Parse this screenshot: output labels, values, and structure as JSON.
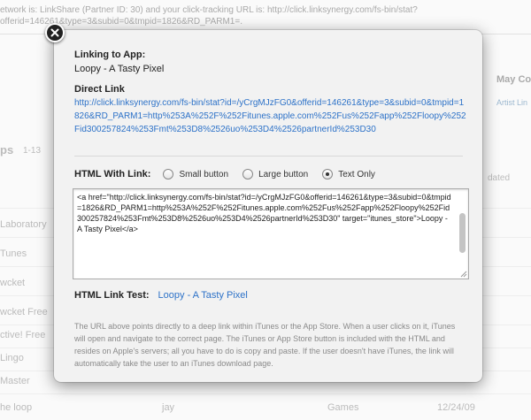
{
  "background": {
    "topline": "etwork is: LinkShare (Partner ID: 30) and your click-tracking URL is: http://click.linksynergy.com/fs-bin/stat?",
    "topline2": "offerid=146261&type=3&subid=0&tmpid=1826&RD_PARM1=.",
    "apps_title": "ps",
    "apps_count": "1-13",
    "side_title": "May Co",
    "side_link": "Artist Lin",
    "updated_header": "dated",
    "rows": [
      {
        "name": "",
        "artist": "",
        "genre": "",
        "date": ""
      },
      {
        "name": "Laboratory",
        "artist": "",
        "genre": "",
        "date": ""
      },
      {
        "name": "Tunes",
        "artist": "",
        "genre": "",
        "date": ""
      },
      {
        "name": "wcket",
        "artist": "",
        "genre": "",
        "date": ""
      },
      {
        "name": "wcket Free",
        "artist": "",
        "genre": "",
        "date": ""
      },
      {
        "name": "ctive! Free",
        "artist": "",
        "genre": "",
        "date": ""
      },
      {
        "name": "Lingo",
        "artist": "",
        "genre": "",
        "date": ""
      },
      {
        "name": "Master",
        "artist": "",
        "genre": "",
        "date": ""
      },
      {
        "name": "he loop",
        "artist": "jay",
        "genre": "Games",
        "date": "12/24/09"
      }
    ]
  },
  "modal": {
    "linking_label": "Linking to App:",
    "app_name": "Loopy - A Tasty Pixel",
    "direct_link_label": "Direct Link",
    "direct_link_url": "http://click.linksynergy.com/fs-bin/stat?id=/yCrgMJzFG0&offerid=146261&type=3&subid=0&tmpid=1826&RD_PARM1=http%253A%252F%252Fitunes.apple.com%252Fus%252Fapp%252Floopy%252Fid300257824%253Fmt%253D8%2526uo%253D4%2526partnerId%253D30",
    "html_with_link_label": "HTML With Link:",
    "radio_options": [
      {
        "label": "Small button",
        "selected": false
      },
      {
        "label": "Large button",
        "selected": false
      },
      {
        "label": "Text Only",
        "selected": true
      }
    ],
    "html_code": "<a href=\"http://click.linksynergy.com/fs-bin/stat?id=/yCrgMJzFG0&offerid=146261&type=3&subid=0&tmpid=1826&RD_PARM1=http%253A%252F%252Fitunes.apple.com%252Fus%252Fapp%252Floopy%252Fid300257824%253Fmt%253D8%2526uo%253D4%2526partnerId%253D30\" target=\"itunes_store\">Loopy - A Tasty Pixel</a>",
    "html_link_test_label": "HTML Link Test:",
    "html_link_test_value": "Loopy - A Tasty Pixel",
    "help_text": "The URL above points directly to a deep link within iTunes or the App Store. When a user clicks on it, iTunes will open and navigate to the correct page. The iTunes or App Store button is included with the HTML and resides on Apple's servers; all you have to do is copy and paste. If the user doesn't have iTunes, the link will automatically take the user to an iTunes download page."
  },
  "icons": {
    "close": "close-icon"
  },
  "colors": {
    "link": "#2d72c8",
    "modal_bg": "#f2f2f2"
  }
}
